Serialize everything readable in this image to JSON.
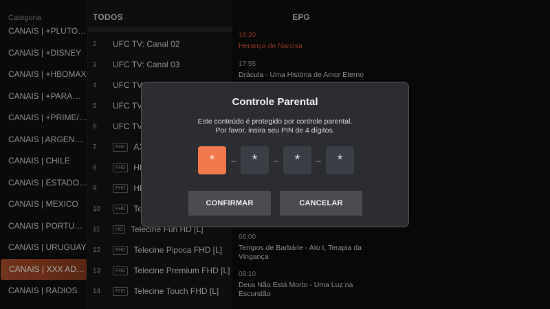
{
  "categories": {
    "header": "Categoria",
    "items": [
      "CANAIS | +PLUTOTV",
      "CANAIS | +DISNEY",
      "CANAIS | +HBOMAX",
      "CANAIS | +PARAMOUNT",
      "CANAIS | +PRIME/DISCOVERY",
      "CANAIS | ARGENTINA",
      "CANAIS | CHILE",
      "CANAIS | ESTADOS UNIDOS",
      "CANAIS | MEXICO",
      "CANAIS | PORTUGAL",
      "CANAIS | URUGUAY",
      "CANAIS | XXX ADULTOS",
      "CANAIS | RADIOS"
    ],
    "active_index": 11
  },
  "channels": {
    "header": "TODOS",
    "rows": [
      {
        "num": "2",
        "badge": "",
        "name": "UFC TV: Canal 02"
      },
      {
        "num": "3",
        "badge": "",
        "name": "UFC TV: Canal 03"
      },
      {
        "num": "4",
        "badge": "",
        "name": "UFC TV: Canal 04"
      },
      {
        "num": "5",
        "badge": "",
        "name": "UFC TV: Canal 05"
      },
      {
        "num": "6",
        "badge": "",
        "name": "UFC TV: Canal 06"
      },
      {
        "num": "7",
        "badge": "FHD",
        "name": "AXN FHD [L]"
      },
      {
        "num": "8",
        "badge": "FHD",
        "name": "HBO 2 FHD [L]"
      },
      {
        "num": "9",
        "badge": "FHD",
        "name": "HBO FHD [L]"
      },
      {
        "num": "10",
        "badge": "FHD",
        "name": "Telecine Cult FHD [L]"
      },
      {
        "num": "11",
        "badge": "HD",
        "name": "Telecine Fun HD [L]"
      },
      {
        "num": "12",
        "badge": "FHD",
        "name": "Telecine Pipoca FHD [L]"
      },
      {
        "num": "13",
        "badge": "FHD",
        "name": "Telecine Premium FHD [L]"
      },
      {
        "num": "14",
        "badge": "FHD",
        "name": "Telecine Touch FHD [L]"
      }
    ]
  },
  "epg": {
    "header": "EPG",
    "entries": [
      {
        "time": "16:20",
        "title": "Herança de Narcisa",
        "now": true
      },
      {
        "time": "17:55",
        "title": "Drácula - Uma História de Amor Eterno",
        "now": false
      },
      {
        "time": "06:00",
        "title": "Tempos de Barbárie - Ato I, Terapia da Vingança",
        "now": false
      },
      {
        "time": "08:10",
        "title": "Deus Não Está Morto - Uma Luz na Escuridão",
        "now": false
      }
    ]
  },
  "dialog": {
    "title": "Controle Parental",
    "message_line1": "Este conteúdo é protegido por controle parental.",
    "message_line2": "Por favor, insira seu PIN de 4 dígitos.",
    "pin": [
      "*",
      "*",
      "*",
      "*"
    ],
    "pin_separator": "–",
    "active_pin_index": 0,
    "confirm_label": "CONFIRMAR",
    "cancel_label": "CANCELAR"
  },
  "colors": {
    "accent": "#f07a4e",
    "active_category": "#b2502e",
    "epg_now": "#d4533a"
  }
}
